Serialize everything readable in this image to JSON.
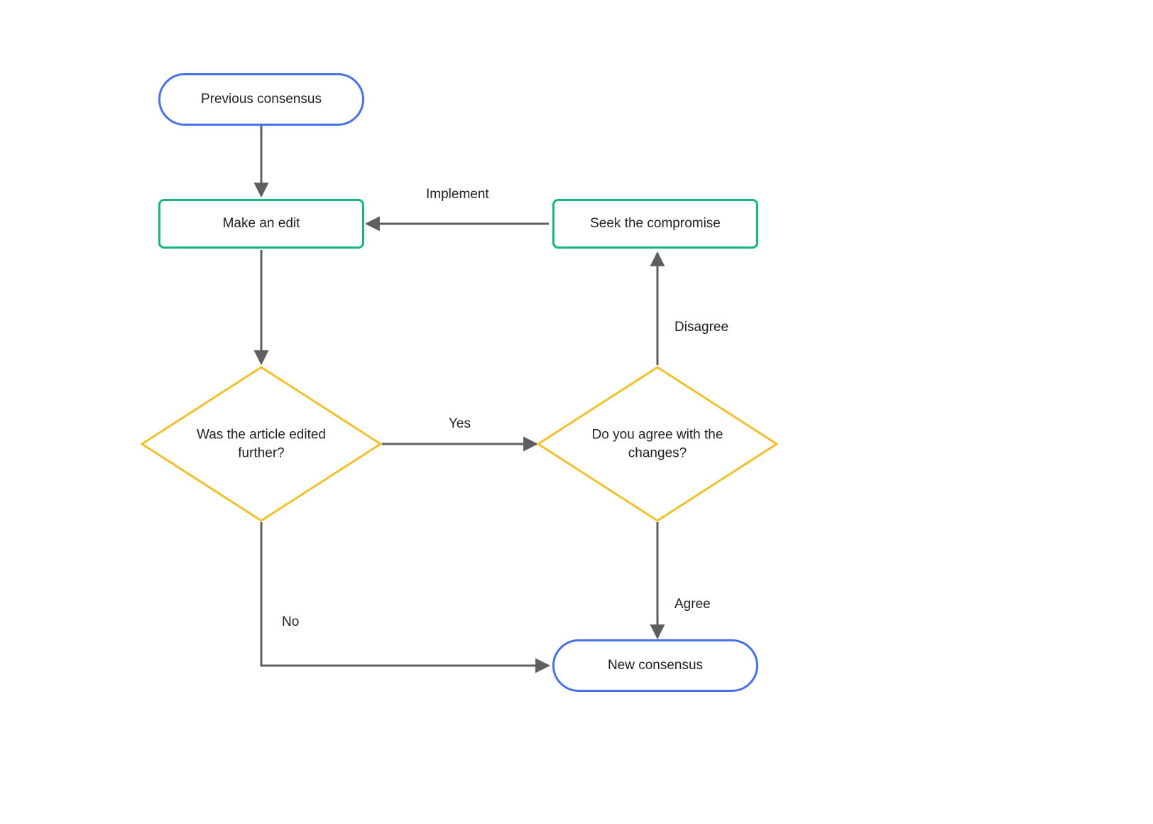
{
  "diagram": {
    "nodes": {
      "start": {
        "label": "Previous consensus"
      },
      "makeEdit": {
        "label": "Make an edit"
      },
      "seekCompromise": {
        "label": "Seek the compromise"
      },
      "wasEdited": {
        "label": "Was the article edited further?"
      },
      "agreeChanges": {
        "label": "Do you agree with the changes?"
      },
      "end": {
        "label": "New consensus"
      }
    },
    "edges": {
      "implement": {
        "label": "Implement"
      },
      "disagree": {
        "label": "Disagree"
      },
      "yes": {
        "label": "Yes"
      },
      "no": {
        "label": "No"
      },
      "agree": {
        "label": "Agree"
      }
    },
    "colors": {
      "terminal": "#4a70e8",
      "process": "#16b77f",
      "decision": "#f2c029",
      "connector": "#5f5f5f"
    }
  }
}
